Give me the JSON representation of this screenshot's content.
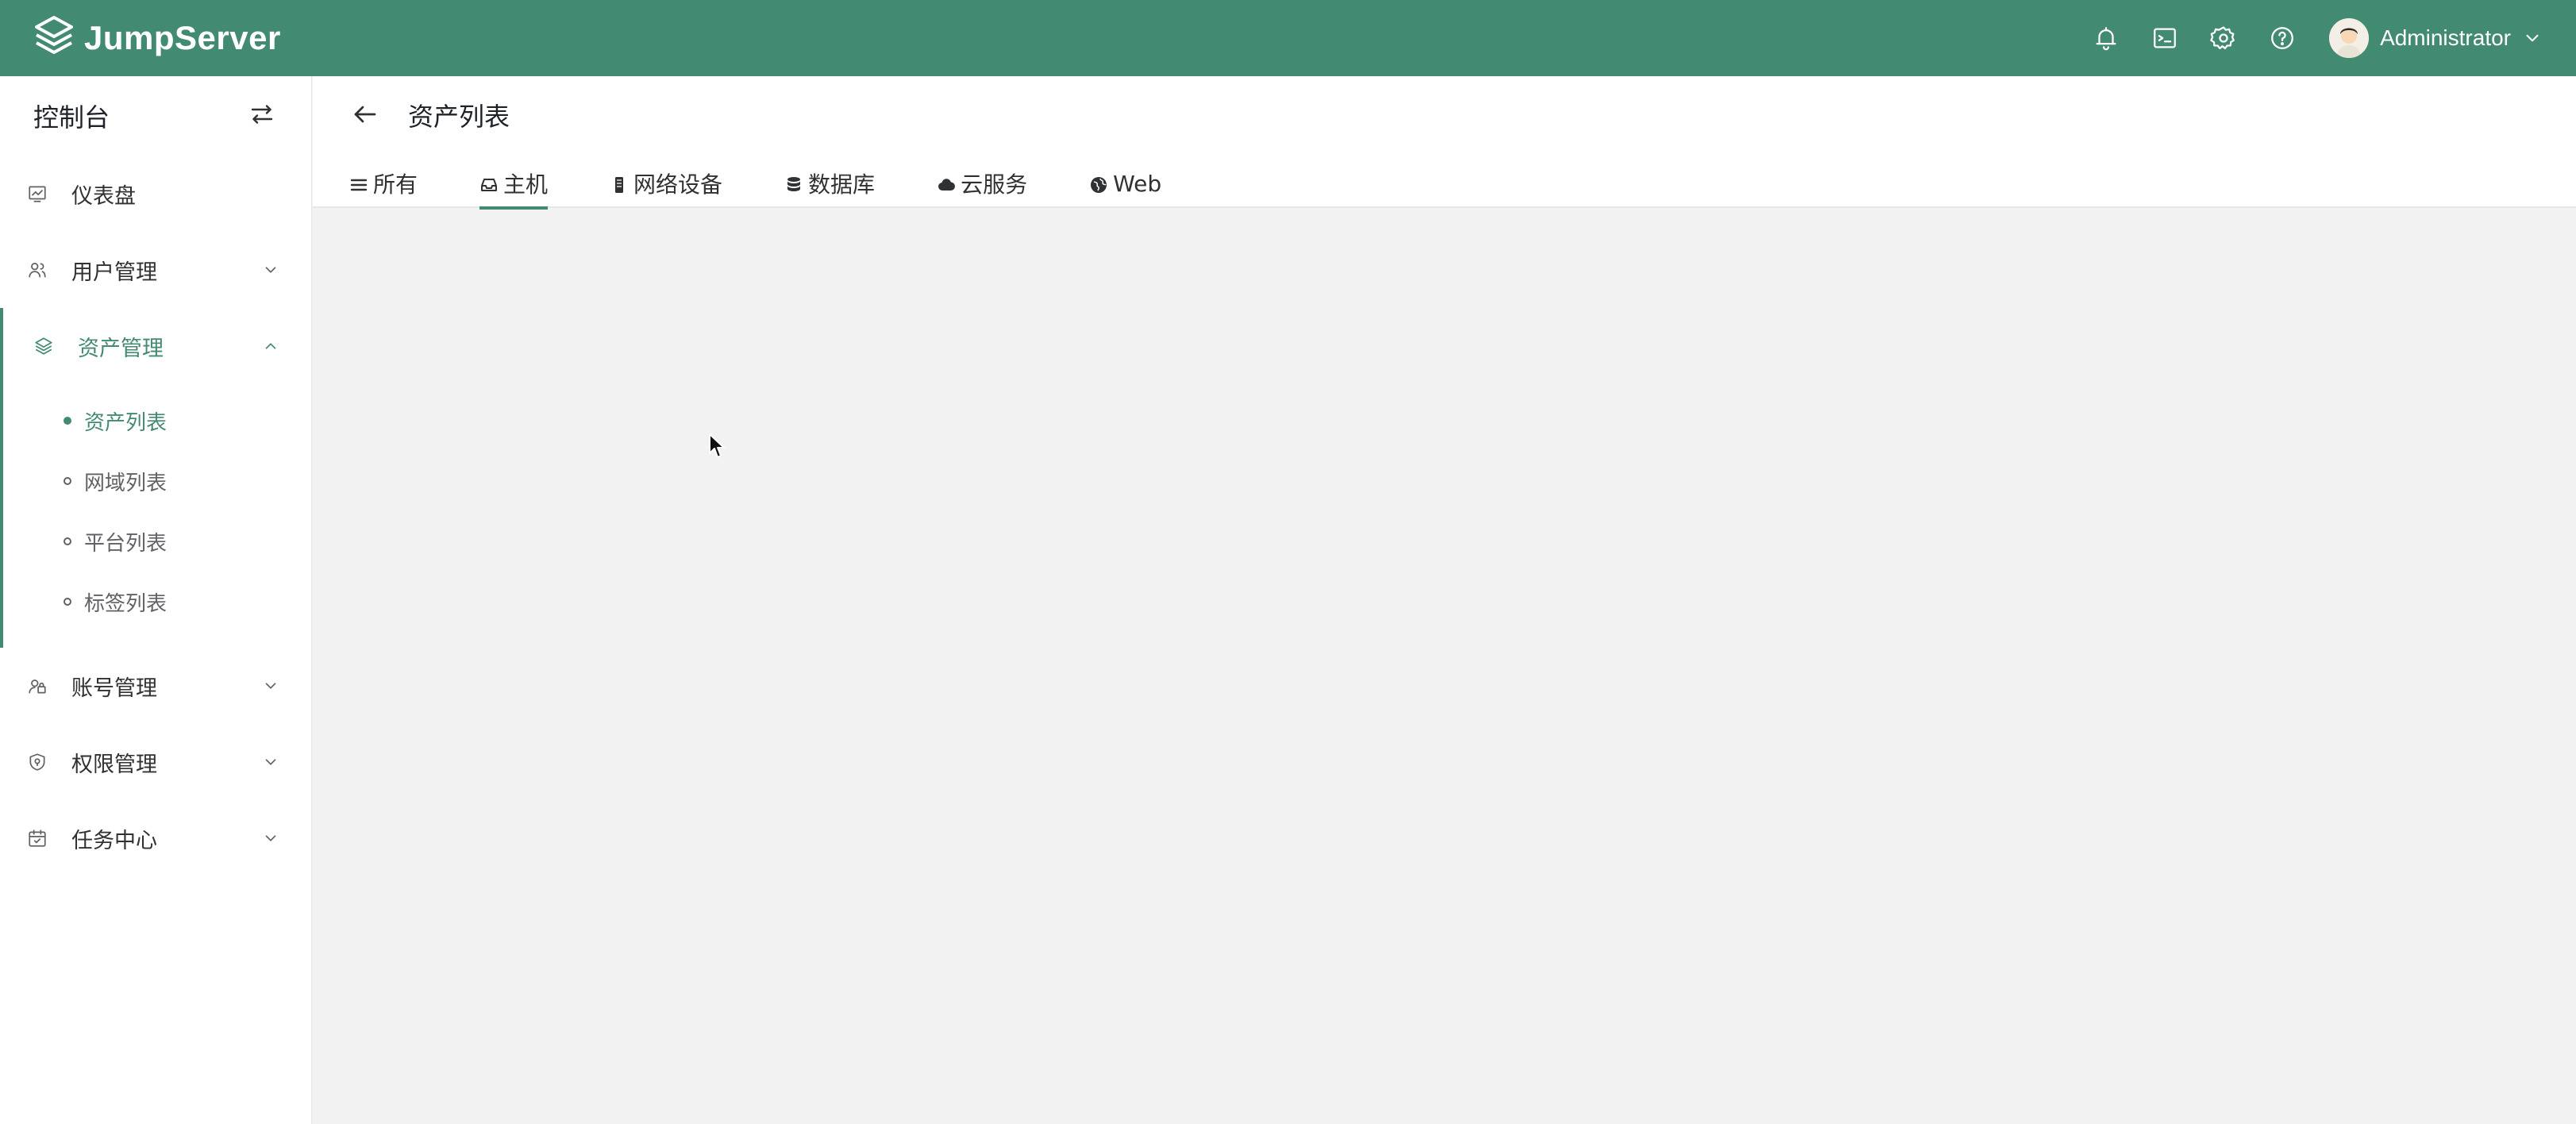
{
  "app": {
    "name": "JumpServer"
  },
  "header": {
    "icons": [
      "bell-icon",
      "terminal-icon",
      "gear-icon",
      "help-icon"
    ],
    "user_name": "Administrator",
    "accent": "#438a72"
  },
  "sidebar": {
    "title": "控制台",
    "items": [
      {
        "label": "仪表盘",
        "icon": "dashboard-icon"
      },
      {
        "label": "用户管理",
        "icon": "users-icon",
        "expandable": true
      },
      {
        "label": "资产管理",
        "icon": "layers-icon",
        "expandable": true,
        "open": true,
        "children": [
          {
            "label": "资产列表",
            "active": true
          },
          {
            "label": "网域列表"
          },
          {
            "label": "平台列表"
          },
          {
            "label": "标签列表"
          }
        ]
      },
      {
        "label": "账号管理",
        "icon": "account-icon",
        "expandable": true
      },
      {
        "label": "权限管理",
        "icon": "shield-icon",
        "expandable": true
      },
      {
        "label": "任务中心",
        "icon": "calendar-icon",
        "expandable": true
      }
    ]
  },
  "page": {
    "title": "资产列表",
    "tabs": [
      {
        "label": "所有",
        "icon": "list-icon"
      },
      {
        "label": "主机",
        "icon": "inbox-icon",
        "active": true
      },
      {
        "label": "网络设备",
        "icon": "device-icon"
      },
      {
        "label": "数据库",
        "icon": "database-icon"
      },
      {
        "label": "云服务",
        "icon": "cloud-icon"
      },
      {
        "label": "Web",
        "icon": "globe-icon"
      }
    ]
  }
}
